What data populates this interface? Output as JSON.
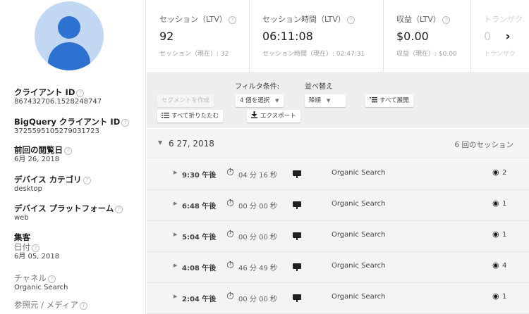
{
  "sidebar": {
    "avatar_icon": "user-avatar-icon",
    "help_glyph": "?",
    "client_id_label": "クライアント ID",
    "client_id_value": "867432706.1528248747",
    "bq_client_id_label": "BigQuery クライアント ID",
    "bq_client_id_value": "3725595105279031723",
    "last_seen_label": "前回の閲覧日",
    "last_seen_value": "6月 26, 2018",
    "device_category_label": "デバイス カテゴリ",
    "device_category_value": "desktop",
    "device_platform_label": "デバイス プラットフォーム",
    "device_platform_value": "web",
    "acquisition_label": "集客",
    "date_label": "日付",
    "date_value": "6月 05, 2018",
    "channel_label": "チャネル",
    "channel_value": "Organic Search",
    "source_medium_label": "参照元 / メディア"
  },
  "metrics": [
    {
      "label": "セッション（LTV）",
      "value": "92",
      "sub": "セッション（現在）: 32"
    },
    {
      "label": "セッション時間（LTV）",
      "value": "06:11:08",
      "sub": "セッション時間（現在）: 02:47:31"
    },
    {
      "label": "収益（LTV）",
      "value": "$0.00",
      "sub": "収益（現在）: $0.00"
    },
    {
      "label": "トランザク",
      "value": "0",
      "sub": "トランザク"
    }
  ],
  "metrics_next_glyph": "›",
  "toolbar": {
    "filter_label": "フィルタ条件:",
    "sort_label": "並べ替え",
    "create_segment": "セグメントを作成",
    "select_count": "4 個を選択",
    "sort_value": "降順",
    "expand_all": "すべて展開",
    "collapse_all": "すべて折りたたむ",
    "export": "エクスポート",
    "caret_glyph": "▼",
    "expand_icon": "expand-list-icon",
    "collapse_icon": "collapse-list-icon",
    "export_icon": "download-icon"
  },
  "timeline": {
    "date_expander": "▼",
    "date": "6 27, 2018",
    "session_count": "6 回のセッション",
    "sessions": [
      {
        "time": "9:30 午後",
        "duration": "04 分 16 秒",
        "channel": "Organic Search",
        "views": "2"
      },
      {
        "time": "6:48 午後",
        "duration": "00 分 00 秒",
        "channel": "Organic Search",
        "views": "1"
      },
      {
        "time": "5:04 午後",
        "duration": "00 分 00 秒",
        "channel": "Organic Search",
        "views": "1"
      },
      {
        "time": "4:08 午後",
        "duration": "46 分 49 秒",
        "channel": "Organic Search",
        "views": "4"
      },
      {
        "time": "2:04 午後",
        "duration": "00 分 00 秒",
        "channel": "Organic Search",
        "views": "1"
      }
    ],
    "row_expander": "▶",
    "timer_glyph": "⏱",
    "eye_glyph": "◉"
  },
  "colors": {
    "avatar_bg": "#c2d8f2",
    "avatar_fg": "#2d72d0",
    "toolbar_bg": "#eeeeee",
    "row_bg": "#f4f4f4"
  }
}
